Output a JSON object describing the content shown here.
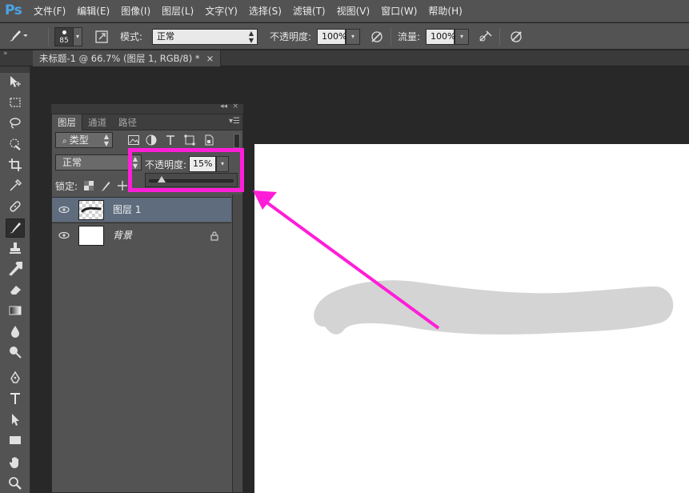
{
  "app": {
    "logo": "Ps"
  },
  "menu": [
    "文件(F)",
    "编辑(E)",
    "图像(I)",
    "图层(L)",
    "文字(Y)",
    "选择(S)",
    "滤镜(T)",
    "视图(V)",
    "窗口(W)",
    "帮助(H)"
  ],
  "options": {
    "brush_size": "85",
    "mode_label": "模式:",
    "mode_value": "正常",
    "opacity_label": "不透明度:",
    "opacity_value": "100%",
    "flow_label": "流量:",
    "flow_value": "100%"
  },
  "document_tab": {
    "title": "未标题-1 @ 66.7% (图层 1, RGB/8) *",
    "close": "×"
  },
  "layers_panel": {
    "tabs": [
      "图层",
      "通道",
      "路径"
    ],
    "filter_label": "类型",
    "blend_mode": "正常",
    "opacity_label": "不透明度:",
    "opacity_value": "15%",
    "opacity_fraction": 0.15,
    "lock_label": "锁定:",
    "layers": [
      {
        "name": "图层 1",
        "selected": true,
        "locked": false
      },
      {
        "name": "背景",
        "selected": false,
        "locked": true
      }
    ]
  },
  "colors": {
    "highlight": "#ff1ed8",
    "stroke": "#d4d4d4",
    "selected_layer": "#5e6c7e",
    "ui_bg": "#535353"
  },
  "icons": [
    "brush-icon",
    "eye-icon",
    "lock-icon",
    "move-icon",
    "marquee-icon",
    "lasso-icon",
    "quick-select-icon",
    "crop-icon",
    "eyedropper-icon",
    "healing-icon",
    "stamp-icon",
    "history-brush-icon",
    "eraser-icon",
    "gradient-icon",
    "blur-icon",
    "dodge-icon",
    "pen-icon",
    "type-icon",
    "path-select-icon",
    "shape-icon",
    "hand-icon",
    "zoom-icon"
  ]
}
